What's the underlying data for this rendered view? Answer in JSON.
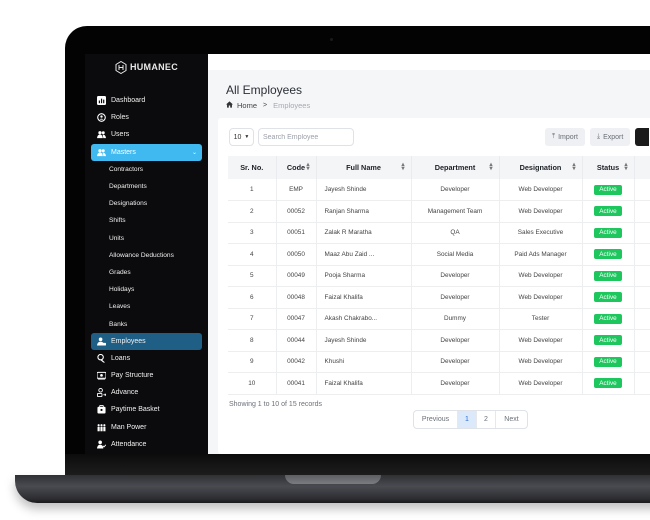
{
  "brand": {
    "name": "HUMANEC",
    "logo_icon": "hexagon-logo-icon"
  },
  "sidebar": {
    "items": [
      {
        "label": "Dashboard",
        "icon": "dashboard-chart-icon"
      },
      {
        "label": "Roles",
        "icon": "roles-badge-icon"
      },
      {
        "label": "Users",
        "icon": "users-icon"
      },
      {
        "label": "Masters",
        "icon": "masters-users-icon",
        "expanded": true
      }
    ],
    "masters_sub": [
      "Contractors",
      "Departments",
      "Designations",
      "Shifts",
      "Units",
      "Allowance Deductions",
      "Grades",
      "Holidays",
      "Leaves",
      "Banks"
    ],
    "items_after": [
      {
        "label": "Employees",
        "icon": "employee-id-icon",
        "active": true
      },
      {
        "label": "Loans",
        "icon": "loans-icon"
      },
      {
        "label": "Pay Structure",
        "icon": "pay-structure-icon"
      },
      {
        "label": "Advance",
        "icon": "advance-icon"
      },
      {
        "label": "Paytime Basket",
        "icon": "basket-icon"
      },
      {
        "label": "Man Power",
        "icon": "man-power-icon"
      },
      {
        "label": "Attendance",
        "icon": "attendance-check-icon"
      }
    ],
    "colors": {
      "expanded_bg": "#3fb9ef",
      "active_bg": "#1f5f86",
      "bg": "#0b0b0d"
    }
  },
  "header": {
    "title": "All Employees",
    "breadcrumb": {
      "home": "Home",
      "separator": ">",
      "current": "Employees"
    }
  },
  "controls": {
    "page_size": "10",
    "search_placeholder": "Search Employee",
    "import_label": "Import",
    "export_label": "Export"
  },
  "table": {
    "columns": [
      "Sr. No.",
      "Code",
      "Full Name",
      "Department",
      "Designation",
      "Status",
      ""
    ],
    "sortable": [
      false,
      true,
      true,
      true,
      true,
      true,
      false
    ],
    "rows": [
      {
        "sr": "1",
        "code": "EMP",
        "name": "Jayesh Shinde",
        "dept": "Developer",
        "desig": "Web Developer",
        "status": "Active"
      },
      {
        "sr": "2",
        "code": "00052",
        "name": "Ranjan Sharma",
        "dept": "Management Team",
        "desig": "Web Developer",
        "status": "Active"
      },
      {
        "sr": "3",
        "code": "00051",
        "name": "Zalak R Maratha",
        "dept": "QA",
        "desig": "Sales Executive",
        "status": "Active"
      },
      {
        "sr": "4",
        "code": "00050",
        "name": "Maaz Abu Zaid ...",
        "dept": "Social Media",
        "desig": "Paid Ads Manager",
        "status": "Active"
      },
      {
        "sr": "5",
        "code": "00049",
        "name": "Pooja Sharma",
        "dept": "Developer",
        "desig": "Web Developer",
        "status": "Active"
      },
      {
        "sr": "6",
        "code": "00048",
        "name": "Faizal Khalifa",
        "dept": "Developer",
        "desig": "Web Developer",
        "status": "Active"
      },
      {
        "sr": "7",
        "code": "00047",
        "name": "Akash Chakrabo...",
        "dept": "Dummy",
        "desig": "Tester",
        "status": "Active"
      },
      {
        "sr": "8",
        "code": "00044",
        "name": "Jayesh Shinde",
        "dept": "Developer",
        "desig": "Web Developer",
        "status": "Active"
      },
      {
        "sr": "9",
        "code": "00042",
        "name": "Khushi",
        "dept": "Developer",
        "desig": "Web Developer",
        "status": "Active"
      },
      {
        "sr": "10",
        "code": "00041",
        "name": "Faizal Khalifa",
        "dept": "Developer",
        "desig": "Web Developer",
        "status": "Active"
      }
    ],
    "status_color": "#1ec65e",
    "action_color": "#18a999"
  },
  "footer": {
    "showing": "Showing 1 to 10 of 15 records",
    "pagination": {
      "previous": "Previous",
      "pages": [
        "1",
        "2"
      ],
      "current": "1",
      "next": "Next"
    }
  }
}
